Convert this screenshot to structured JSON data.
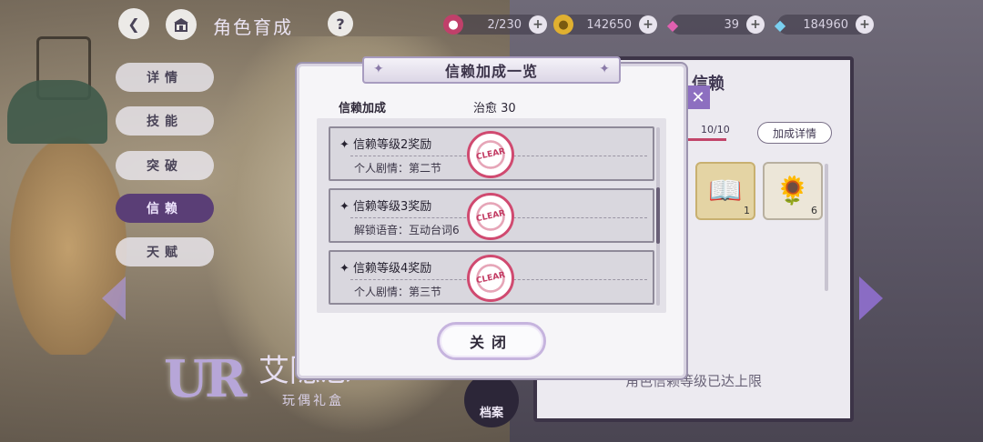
{
  "topbar": {
    "title": "角色育成",
    "help": "?",
    "resources": [
      {
        "icon": "candy-icon",
        "value": "2/230"
      },
      {
        "icon": "coin-icon",
        "value": "142650"
      },
      {
        "icon": "pink-gem-icon",
        "value": "39"
      },
      {
        "icon": "blue-diamond-icon",
        "value": "184960"
      }
    ]
  },
  "tabs": [
    {
      "label": "详情",
      "active": false
    },
    {
      "label": "技能",
      "active": false
    },
    {
      "label": "突破",
      "active": false
    },
    {
      "label": "信赖",
      "active": true
    },
    {
      "label": "天赋",
      "active": false
    }
  ],
  "character": {
    "rarity": "UR",
    "name": "艾隐忌",
    "subtitle": "玩偶礼盒",
    "archive_label": "档案"
  },
  "trust_panel": {
    "title": "信赖",
    "progress": "10/10",
    "detail_button": "加成详情",
    "items": [
      {
        "icon": "book-icon",
        "count": "1"
      },
      {
        "icon": "bouquet-icon",
        "count": "6"
      }
    ],
    "footer": "角色信赖等级已达上限"
  },
  "modal": {
    "title": "信赖加成一览",
    "bonus_label": "信赖加成",
    "bonus_value": "治愈 30",
    "rewards": [
      {
        "title": "信赖等级2奖励",
        "desc": "个人剧情：第二节",
        "stamp": "CLEAR"
      },
      {
        "title": "信赖等级3奖励",
        "desc": "解锁语音：互动台词6",
        "stamp": "CLEAR"
      },
      {
        "title": "信赖等级4奖励",
        "desc": "个人剧情：第三节",
        "stamp": "CLEAR"
      }
    ],
    "close_label": "关闭"
  },
  "colors": {
    "accent_purple": "#5a3e76",
    "stamp_red": "#d04a70",
    "nav_arrow": "#8a6cc4"
  }
}
